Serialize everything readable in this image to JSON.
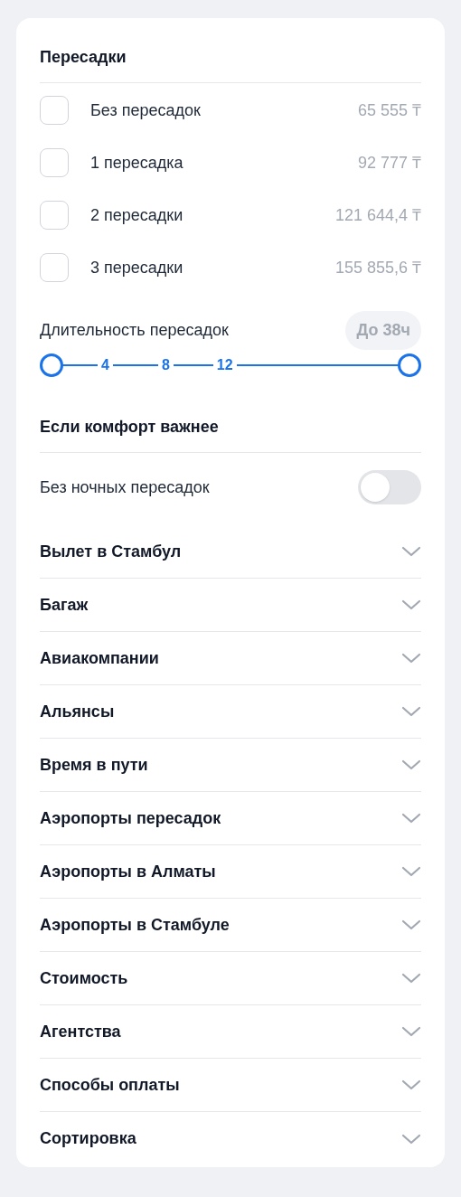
{
  "transfers": {
    "title": "Пересадки",
    "options": [
      {
        "label": "Без пересадок",
        "price": "65 555 ₸",
        "checked": false
      },
      {
        "label": "1 пересадка",
        "price": "92 777 ₸",
        "checked": false
      },
      {
        "label": "2 пересадки",
        "price": "121 644,4 ₸",
        "checked": false
      },
      {
        "label": "3 пересадки",
        "price": "155 855,6 ₸",
        "checked": false
      }
    ]
  },
  "duration": {
    "label": "Длительность пересадок",
    "badge": "До 38ч",
    "ticks": [
      "4",
      "8",
      "12"
    ],
    "thumbs": [
      {
        "level": 0
      },
      {
        "level": 1
      }
    ]
  },
  "comfort": {
    "title": "Если комфорт важнее",
    "toggles": [
      {
        "label": "Без ночных пересадок",
        "on": false
      }
    ]
  },
  "sections": [
    {
      "title": "Вылет в Стамбул",
      "expanded": false
    },
    {
      "title": "Багаж",
      "expanded": false
    },
    {
      "title": "Авиакомпании",
      "expanded": false
    },
    {
      "title": "Альянсы",
      "expanded": false
    },
    {
      "title": "Время в пути",
      "expanded": false
    },
    {
      "title": "Аэропорты пересадок",
      "expanded": false
    },
    {
      "title": "Аэропорты в Алматы",
      "expanded": false
    },
    {
      "title": "Аэропорты в Стамбуле",
      "expanded": false
    },
    {
      "title": "Стоимость",
      "expanded": false
    },
    {
      "title": "Агентства",
      "expanded": false
    },
    {
      "title": "Способы оплаты",
      "expanded": false
    },
    {
      "title": "Сортировка",
      "expanded": false
    }
  ]
}
